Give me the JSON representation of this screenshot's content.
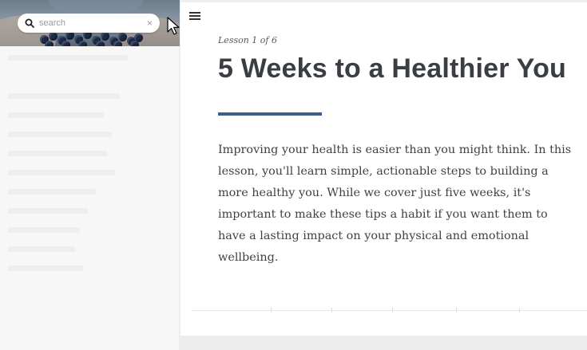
{
  "sidebar": {
    "search": {
      "placeholder": "search",
      "value": "",
      "icon": "search-icon",
      "clear_icon": "close-icon",
      "clear_label": "×"
    },
    "hero_image": "blueberries-in-hands"
  },
  "toolbar": {
    "menu_icon": "hamburger-menu-icon"
  },
  "lesson": {
    "label": "Lesson 1 of 6",
    "title": "5 Weeks to a Healthier You",
    "body": "Improving your health is easier than you might think. In this lesson, you'll learn simple, actionable steps to building a more healthy you. While we cover just five weeks, it's important to make these tips a habit if you want them to have a lasting impact on your physical and emotional wellbeing."
  },
  "colors": {
    "accent": "#3b5f8a",
    "title_text": "#3a3d42",
    "body_text": "#3e4146",
    "sidebar_bg": "#f7f7f7",
    "page_bg": "#f0f0f0"
  }
}
